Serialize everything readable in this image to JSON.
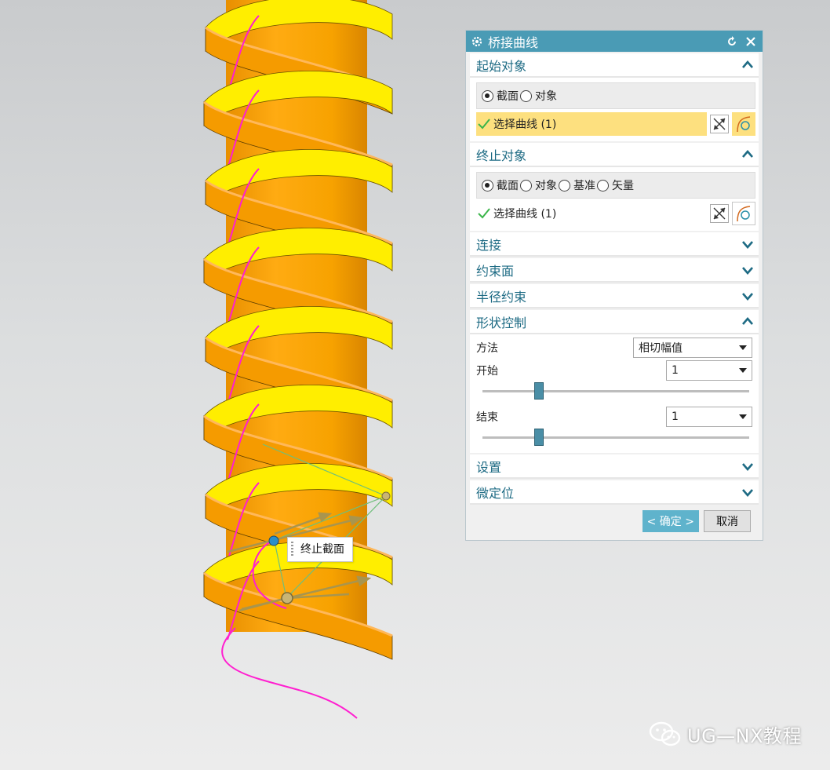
{
  "dialog": {
    "title": "桥接曲线",
    "start_object": {
      "header": "起始对象",
      "radio_section": "截面",
      "radio_object": "对象",
      "select_curve": "选择曲线 (1)"
    },
    "end_object": {
      "header": "终止对象",
      "radio_section": "截面",
      "radio_object": "对象",
      "radio_datum": "基准",
      "radio_vector": "矢量",
      "select_curve": "选择曲线 (1)"
    },
    "collapsed_sections": {
      "connection": "连接",
      "constraint_face": "约束面",
      "radius_constraint": "半径约束"
    },
    "shape_control": {
      "header": "形状控制",
      "method_label": "方法",
      "method_value": "相切幅值",
      "start_label": "开始",
      "start_value": "1",
      "start_level": 0.2,
      "end_label": "结束",
      "end_value": "1",
      "end_level": 0.2
    },
    "settings": "设置",
    "fine_position": "微定位",
    "ok_label": "< 确定 >",
    "cancel_label": "取消"
  },
  "viewport": {
    "tooltip": "终止截面"
  },
  "watermark": "UG—NX教程",
  "colors": {
    "accent": "#4a9bb5",
    "section_header_text": "#1e6b84",
    "active_selection": "#fde07f",
    "shaft_orange": "#f7a200",
    "thread_yellow": "#ffee00",
    "helix_curve": "#ff1fd0"
  }
}
